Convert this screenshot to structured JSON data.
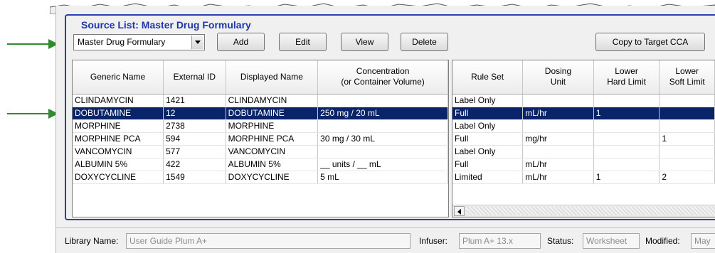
{
  "source_list": {
    "title": "Source List: Master Drug Formulary",
    "dropdown_value": "Master Drug Formulary",
    "buttons": {
      "add": "Add",
      "edit": "Edit",
      "view": "View",
      "delete": "Delete",
      "copy": "Copy to Target CCA"
    }
  },
  "drug_table": {
    "headers": [
      "Generic Name",
      "External ID",
      "Displayed Name",
      "Concentration\n(or Container Volume)"
    ],
    "rows": [
      [
        "CLINDAMYCIN",
        "1421",
        "CLINDAMYCIN",
        ""
      ],
      [
        "DOBUTAMINE",
        "12",
        "DOBUTAMINE",
        "250 mg / 20 mL"
      ],
      [
        "MORPHINE",
        "2738",
        "MORPHINE",
        ""
      ],
      [
        "MORPHINE PCA",
        "594",
        "MORPHINE PCA",
        "30 mg / 30 mL"
      ],
      [
        "VANCOMYCIN",
        "577",
        "VANCOMYCIN",
        ""
      ],
      [
        "ALBUMIN 5%",
        "422",
        "ALBUMIN 5%",
        "__ units / __ mL"
      ],
      [
        "DOXYCYCLINE",
        "1549",
        "DOXYCYCLINE",
        "5 mL"
      ]
    ],
    "selected_row": 1
  },
  "rule_table": {
    "headers": [
      "Rule Set",
      "Dosing\nUnit",
      "Lower\nHard Limit",
      "Lower\nSoft Limit"
    ],
    "rows": [
      [
        "Label Only",
        "",
        "",
        ""
      ],
      [
        "Full",
        "mL/hr",
        "1",
        ""
      ],
      [
        "Label Only",
        "",
        "",
        ""
      ],
      [
        "Full",
        "mg/hr",
        "",
        "1"
      ],
      [
        "Label Only",
        "",
        "",
        ""
      ],
      [
        "Full",
        "mL/hr",
        "",
        ""
      ],
      [
        "Limited",
        "mL/hr",
        "1",
        "2"
      ]
    ]
  },
  "status_bar": {
    "library_label": "Library Name:",
    "library_value": "User Guide Plum A+",
    "infuser_label": "Infuser:",
    "infuser_value": "Plum A+ 13.x",
    "status_label": "Status:",
    "status_value": "Worksheet",
    "modified_label": "Modified:",
    "modified_value": "May"
  },
  "colors": {
    "group_title": "#1f36a8",
    "selection": "#0a246a",
    "callout_arrow": "#2e8b2e"
  }
}
